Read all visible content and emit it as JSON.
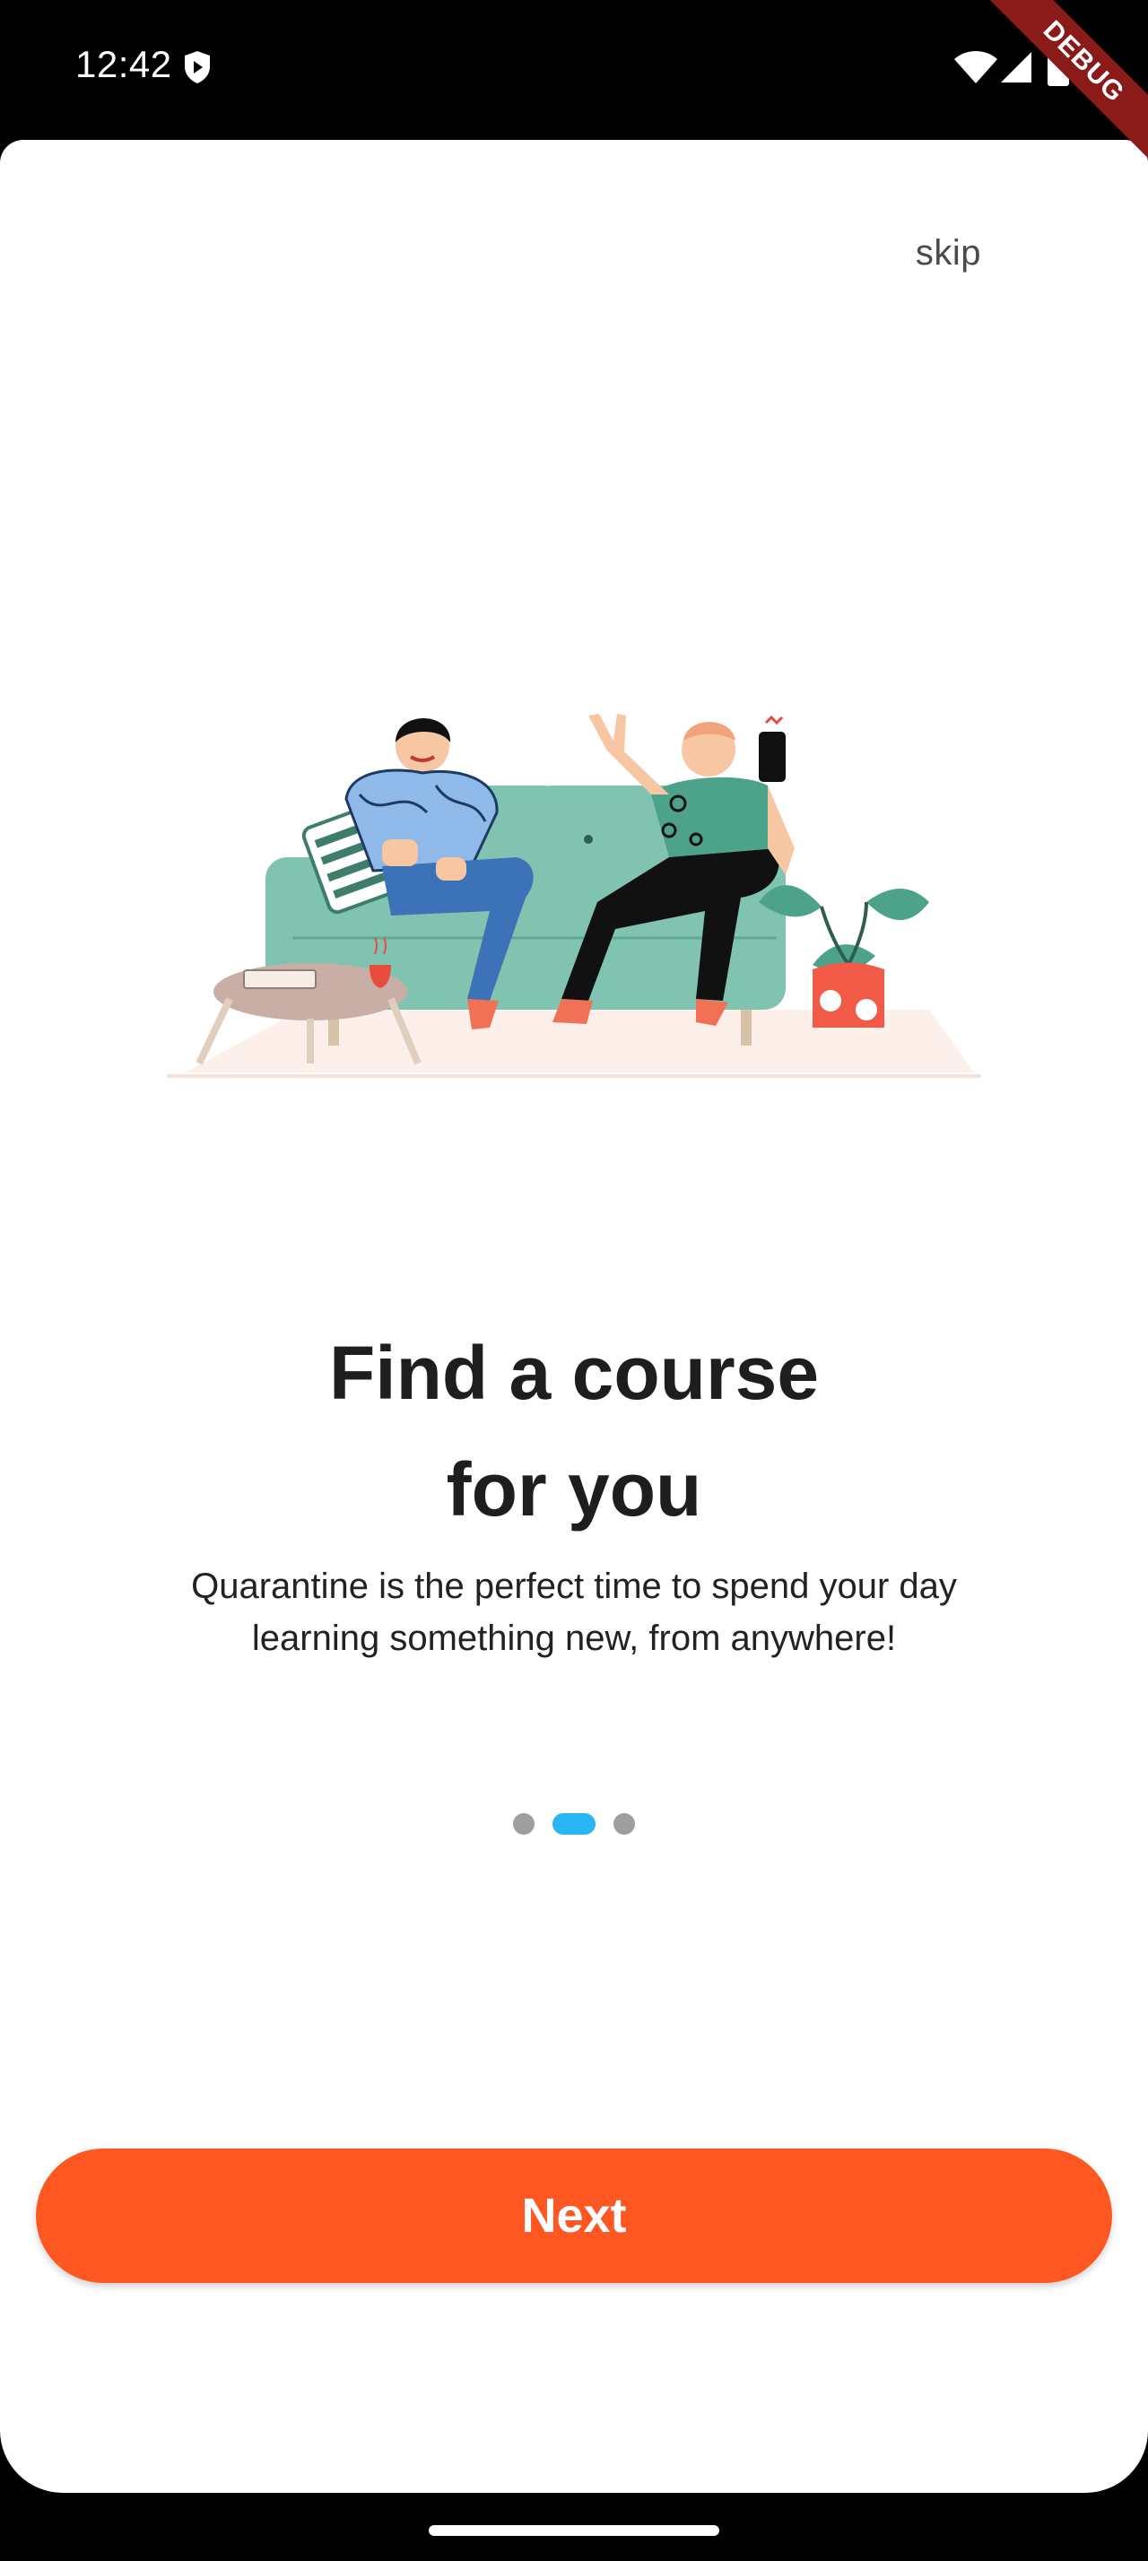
{
  "status_bar": {
    "time": "12:42",
    "icons": [
      "shield-icon",
      "wifi-icon",
      "signal-icon",
      "battery-icon"
    ]
  },
  "debug_banner": {
    "label": "DEBUG",
    "color": "#8b1a1a"
  },
  "onboarding": {
    "skip_label": "skip",
    "illustration": "two-people-on-sofa-illustration",
    "title_line1": "Find a course",
    "title_line2": "for you",
    "description": "Quarantine is the perfect time to spend your day learning something new, from anywhere!",
    "page_indicator": {
      "total": 3,
      "current": 2,
      "active_color": "#29b6f6",
      "inactive_color": "#9e9e9e"
    },
    "next_label": "Next",
    "accent_color": "#ff5722"
  }
}
